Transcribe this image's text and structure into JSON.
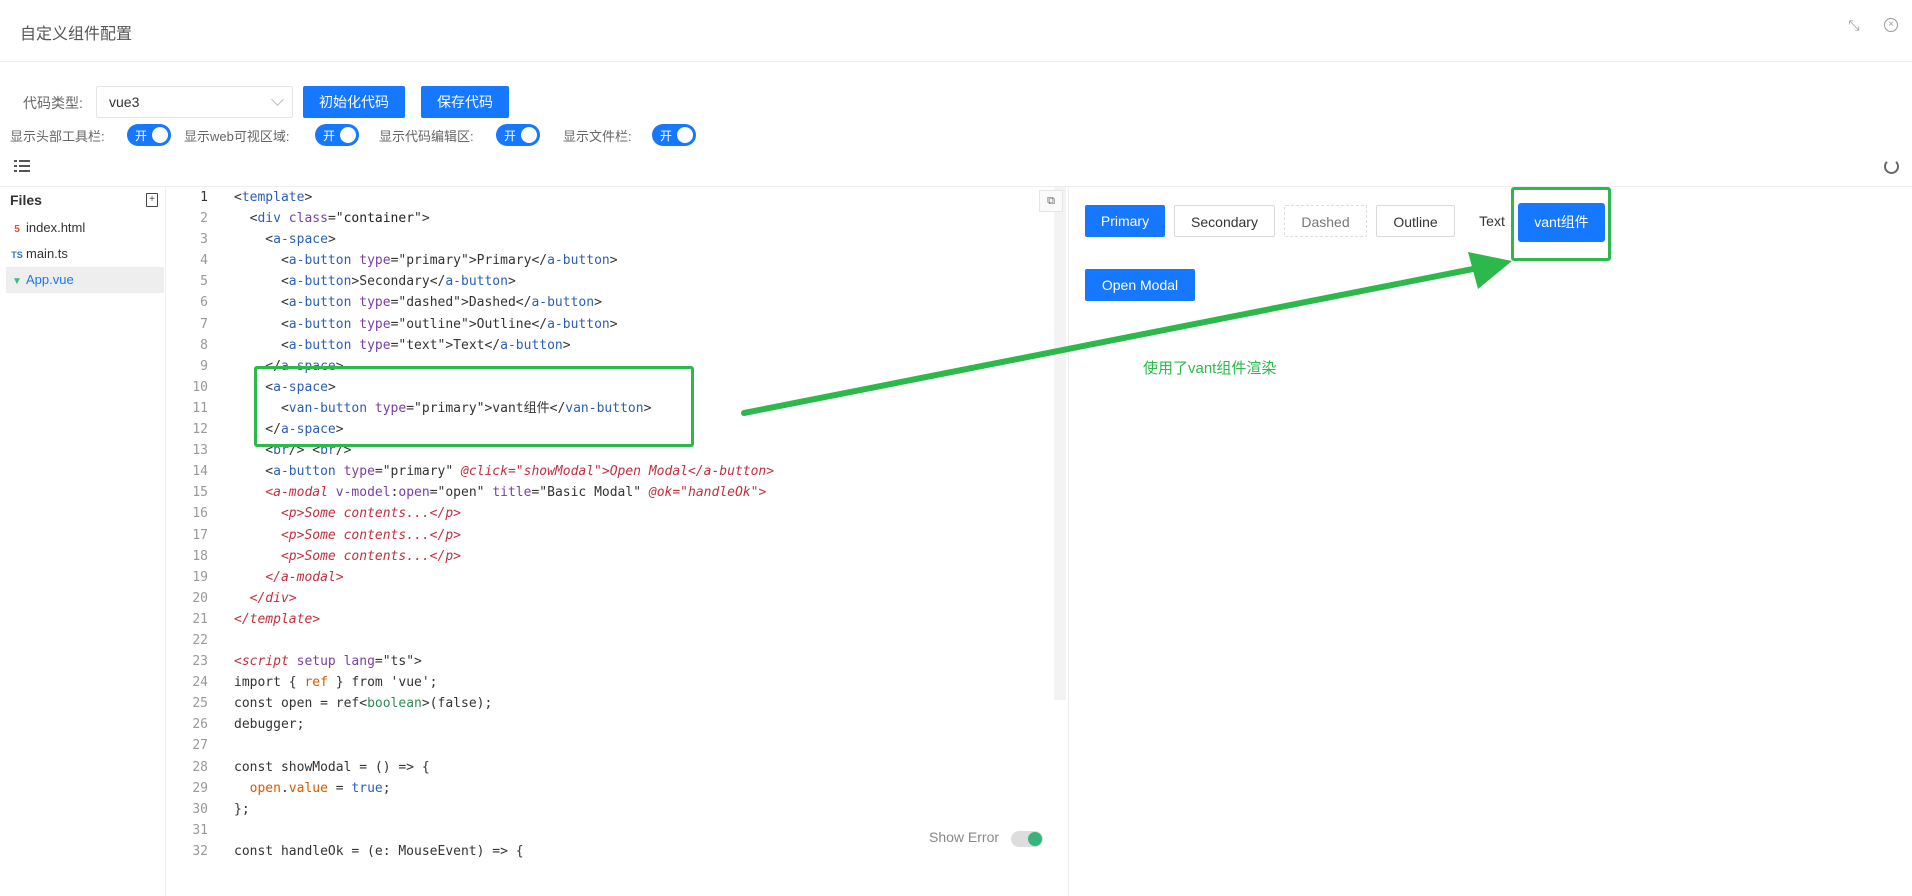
{
  "window": {
    "title": "自定义组件配置",
    "collapse_icon": "shrink-icon",
    "close_icon": "close-icon"
  },
  "toolbar": {
    "code_type_label": "代码类型:",
    "code_type_value": "vue3",
    "init_button": "初始化代码",
    "save_button": "保存代码"
  },
  "switches": [
    {
      "label": "显示头部工具栏:",
      "state": "开"
    },
    {
      "label": "显示web可视区域:",
      "state": "开"
    },
    {
      "label": "显示代码编辑区:",
      "state": "开"
    },
    {
      "label": "显示文件栏:",
      "state": "开"
    }
  ],
  "files": {
    "header": "Files",
    "items": [
      {
        "name": "index.html",
        "icon": "html5-icon",
        "badge": "5",
        "active": false
      },
      {
        "name": "main.ts",
        "icon": "ts-icon",
        "badge": "TS",
        "active": false
      },
      {
        "name": "App.vue",
        "icon": "vue-icon",
        "badge": "▼",
        "active": true
      }
    ]
  },
  "editor": {
    "show_error_label": "Show Error",
    "line_numbers": [
      "1",
      "2",
      "3",
      "4",
      "5",
      "6",
      "7",
      "8",
      "9",
      "10",
      "11",
      "12",
      "13",
      "14",
      "15",
      "16",
      "17",
      "18",
      "19",
      "20",
      "21",
      "22",
      "23",
      "24",
      "25",
      "26",
      "27",
      "28",
      "29",
      "30",
      "31",
      "32"
    ]
  },
  "preview": {
    "buttons": [
      "Primary",
      "Secondary",
      "Dashed",
      "Outline",
      "Text"
    ],
    "vant_button": "vant组件",
    "open_modal": "Open Modal",
    "annotation": "使用了vant组件渲染",
    "colors": {
      "primary": "#1677ff",
      "annotation": "#2db84b"
    }
  }
}
